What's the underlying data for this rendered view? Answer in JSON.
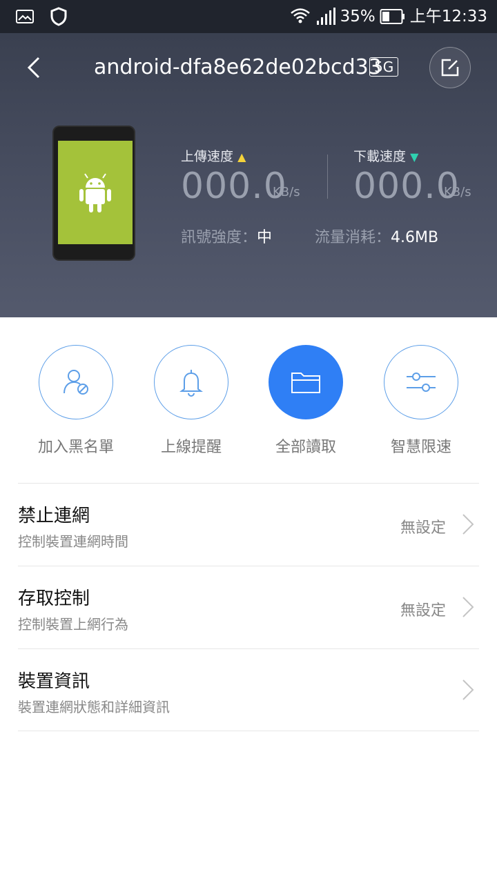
{
  "status_bar": {
    "battery": "35%",
    "time": "上午12:33",
    "icons": [
      "image-icon",
      "shield-icon",
      "wifi-icon",
      "signal-icon",
      "battery-icon"
    ]
  },
  "header": {
    "title": "android-dfa8e62de02bcd33",
    "band": "5G",
    "upload_label": "上傳速度",
    "upload_value": "000.0",
    "upload_unit": "KB/s",
    "download_label": "下載速度",
    "download_value": "000.0",
    "download_unit": "KB/s",
    "signal_label": "訊號強度：",
    "signal_value": "中",
    "traffic_label": "流量消耗：",
    "traffic_value": "4.6MB",
    "colors": {
      "upload_arrow": "#f5d33a",
      "download_arrow": "#2fd2b0",
      "device_screen": "#a4c23a"
    }
  },
  "actions": [
    {
      "label": "加入黑名單",
      "icon": "block-user-icon",
      "active": false
    },
    {
      "label": "上線提醒",
      "icon": "bell-icon",
      "active": false
    },
    {
      "label": "全部讀取",
      "icon": "folder-icon",
      "active": true
    },
    {
      "label": "智慧限速",
      "icon": "sliders-icon",
      "active": false
    }
  ],
  "accent": "#2f7ff5",
  "list": [
    {
      "title": "禁止連網",
      "subtitle": "控制裝置連網時間",
      "value": "無設定"
    },
    {
      "title": "存取控制",
      "subtitle": "控制裝置上網行為",
      "value": "無設定"
    },
    {
      "title": "裝置資訊",
      "subtitle": "裝置連網狀態和詳細資訊",
      "value": ""
    }
  ]
}
